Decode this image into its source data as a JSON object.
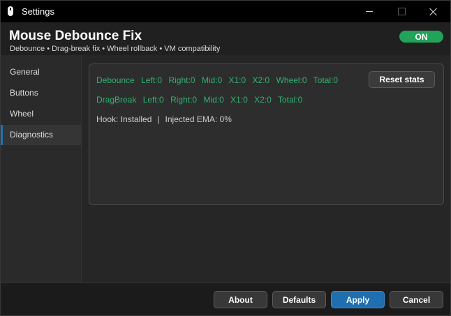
{
  "window": {
    "title": "Settings"
  },
  "header": {
    "title": "Mouse Debounce Fix",
    "subtitle": "Debounce • Drag-break fix • Wheel rollback • VM compatibility",
    "toggle_label": "ON",
    "toggle_on": true,
    "accent": "#22a35a"
  },
  "sidebar": {
    "items": [
      {
        "label": "General",
        "active": false
      },
      {
        "label": "Buttons",
        "active": false
      },
      {
        "label": "Wheel",
        "active": false
      },
      {
        "label": "Diagnostics",
        "active": true
      }
    ]
  },
  "diagnostics": {
    "debounce": {
      "label": "Debounce",
      "stats": [
        "Left:0",
        "Right:0",
        "Mid:0",
        "X1:0",
        "X2:0",
        "Wheel:0",
        "Total:0"
      ]
    },
    "dragbreak": {
      "label": "DragBreak",
      "stats": [
        "Left:0",
        "Right:0",
        "Mid:0",
        "X1:0",
        "X2:0",
        "Total:0"
      ]
    },
    "hook_status": "Hook: Installed",
    "separator": "|",
    "injected_ema": "Injected EMA: 0%",
    "reset_label": "Reset stats",
    "stats_color": "#2fb36e"
  },
  "footer": {
    "about_label": "About",
    "defaults_label": "Defaults",
    "apply_label": "Apply",
    "cancel_label": "Cancel",
    "primary_color": "#1f6fb0"
  }
}
